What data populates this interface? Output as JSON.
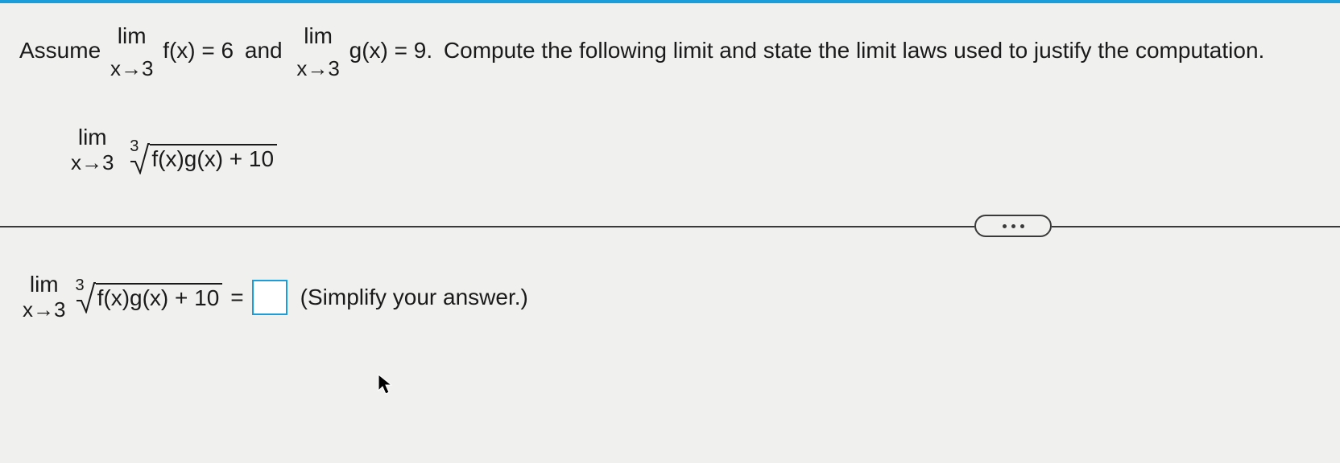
{
  "question": {
    "prefix": "Assume",
    "lim1_top": "lim",
    "lim1_bot": "x→3",
    "lim1_expr": "f(x) = 6",
    "conj": "and",
    "lim2_top": "lim",
    "lim2_bot": "x→3",
    "lim2_expr": "g(x) = 9.",
    "suffix": "Compute the following limit and state the limit laws used to justify the computation."
  },
  "expression": {
    "lim_top": "lim",
    "lim_bot": "x→3",
    "root_index": "3",
    "radicand": "f(x)g(x) + 10"
  },
  "answer": {
    "lim_top": "lim",
    "lim_bot": "x→3",
    "root_index": "3",
    "radicand": "f(x)g(x) + 10",
    "equals": "=",
    "hint": "(Simplify your answer.)"
  }
}
